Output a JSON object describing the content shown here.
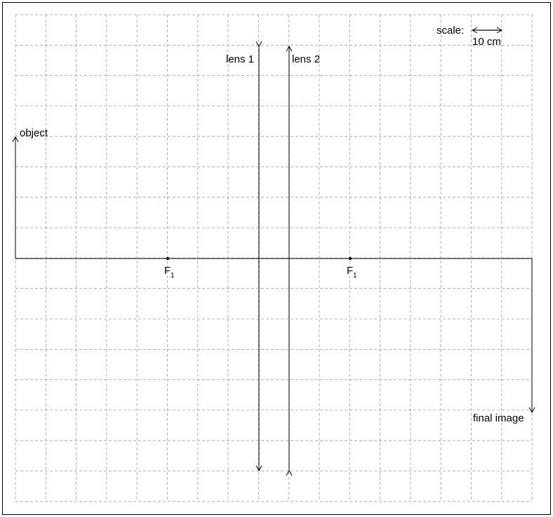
{
  "labels": {
    "scale": "scale:",
    "scale_value": "10 cm",
    "lens1": "lens 1",
    "lens2": "lens 2",
    "object": "object",
    "final_image": "final image",
    "focal_left": "F",
    "focal_left_sub": "1",
    "focal_right": "F",
    "focal_right_sub": "1"
  },
  "colors": {
    "grid": "#9a9a9a",
    "lines": "#000000",
    "frame": "#000000"
  }
}
